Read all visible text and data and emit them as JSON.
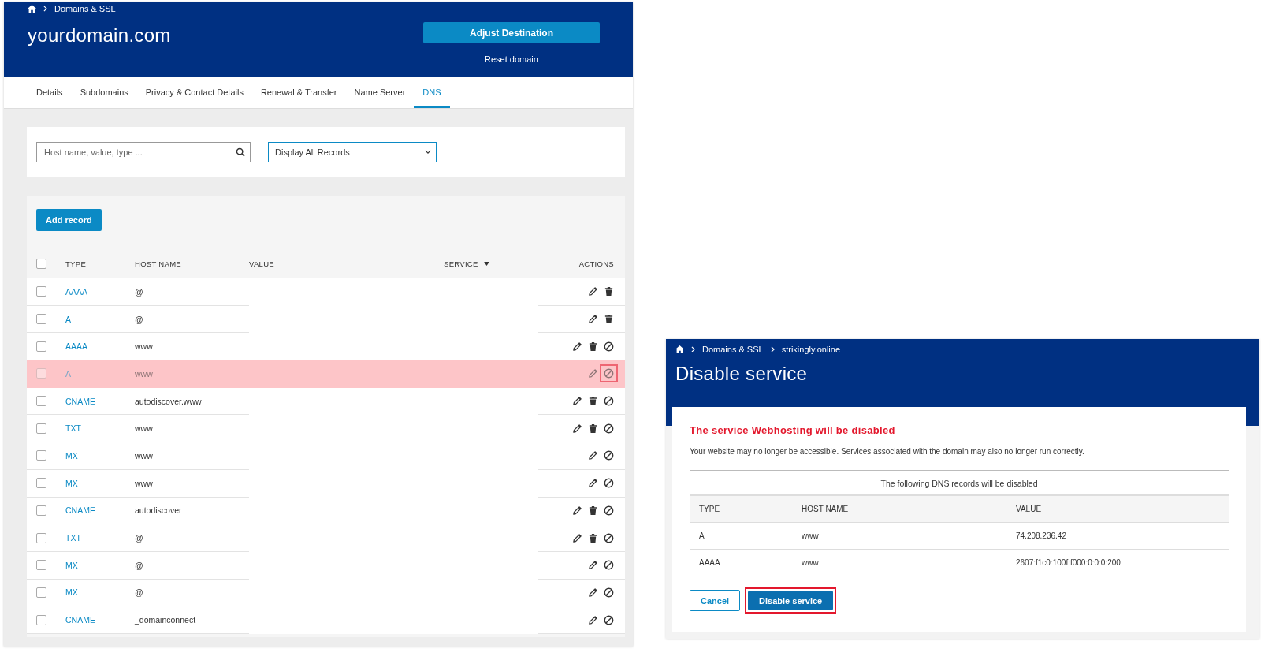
{
  "main_page": {
    "breadcrumb": [
      "Domains & SSL"
    ],
    "title": "yourdomain.com",
    "primary_button": "Adjust Destination",
    "secondary_link": "Reset domain",
    "tabs": [
      {
        "label": "Details",
        "selected": false
      },
      {
        "label": "Subdomains",
        "selected": false
      },
      {
        "label": "Privacy & Contact Details",
        "selected": false
      },
      {
        "label": "Renewal & Transfer",
        "selected": false
      },
      {
        "label": "Name Server",
        "selected": false
      },
      {
        "label": "DNS",
        "selected": true
      }
    ],
    "search": {
      "placeholder": "Host name, value, type ..."
    },
    "filter": {
      "value": "Display All Records"
    },
    "add_button": "Add record",
    "table": {
      "all_checked": false,
      "columns": [
        {
          "label": "TYPE",
          "sorted": false
        },
        {
          "label": "HOST NAME",
          "sorted": false
        },
        {
          "label": "VALUE",
          "sorted": false
        },
        {
          "label": "SERVICE",
          "sorted": true
        },
        {
          "label": "ACTIONS",
          "sorted": false
        }
      ],
      "rows": [
        {
          "type": "AAAA",
          "host": "@",
          "checked": false,
          "highlighted": false,
          "actions": [
            {
              "kind": "edit"
            },
            {
              "kind": "delete"
            }
          ]
        },
        {
          "type": "A",
          "host": "@",
          "checked": false,
          "highlighted": false,
          "actions": [
            {
              "kind": "edit"
            },
            {
              "kind": "delete"
            }
          ]
        },
        {
          "type": "AAAA",
          "host": "www",
          "checked": false,
          "highlighted": false,
          "actions": [
            {
              "kind": "edit"
            },
            {
              "kind": "delete"
            },
            {
              "kind": "disable"
            }
          ]
        },
        {
          "type": "A",
          "host": "www",
          "checked": false,
          "highlighted": true,
          "actions": [
            {
              "kind": "edit"
            },
            {
              "kind": "disable"
            }
          ]
        },
        {
          "type": "CNAME",
          "host": "autodiscover.www",
          "checked": false,
          "highlighted": false,
          "actions": [
            {
              "kind": "edit"
            },
            {
              "kind": "delete"
            },
            {
              "kind": "disable"
            }
          ]
        },
        {
          "type": "TXT",
          "host": "www",
          "checked": false,
          "highlighted": false,
          "actions": [
            {
              "kind": "edit"
            },
            {
              "kind": "delete"
            },
            {
              "kind": "disable"
            }
          ]
        },
        {
          "type": "MX",
          "host": "www",
          "checked": false,
          "highlighted": false,
          "actions": [
            {
              "kind": "edit"
            },
            {
              "kind": "disable"
            }
          ]
        },
        {
          "type": "MX",
          "host": "www",
          "checked": false,
          "highlighted": false,
          "actions": [
            {
              "kind": "edit"
            },
            {
              "kind": "disable"
            }
          ]
        },
        {
          "type": "CNAME",
          "host": "autodiscover",
          "checked": false,
          "highlighted": false,
          "actions": [
            {
              "kind": "edit"
            },
            {
              "kind": "delete"
            },
            {
              "kind": "disable"
            }
          ]
        },
        {
          "type": "TXT",
          "host": "@",
          "checked": false,
          "highlighted": false,
          "actions": [
            {
              "kind": "edit"
            },
            {
              "kind": "delete"
            },
            {
              "kind": "disable"
            }
          ]
        },
        {
          "type": "MX",
          "host": "@",
          "checked": false,
          "highlighted": false,
          "actions": [
            {
              "kind": "edit"
            },
            {
              "kind": "disable"
            }
          ]
        },
        {
          "type": "MX",
          "host": "@",
          "checked": false,
          "highlighted": false,
          "actions": [
            {
              "kind": "edit"
            },
            {
              "kind": "disable"
            }
          ]
        },
        {
          "type": "CNAME",
          "host": "_domainconnect",
          "checked": false,
          "highlighted": false,
          "actions": [
            {
              "kind": "edit"
            },
            {
              "kind": "disable"
            }
          ]
        }
      ]
    }
  },
  "dialog": {
    "breadcrumb": [
      "Domains & SSL",
      "strikingly.online"
    ],
    "title": "Disable service",
    "warning": "The service Webhosting will be disabled",
    "message": "Your website may no longer be accessible. Services associated with the domain may also no longer run correctly.",
    "records_caption": "The following DNS records will be disabled",
    "columns": [
      "TYPE",
      "HOST NAME",
      "VALUE"
    ],
    "rows": [
      {
        "type": "A",
        "host": "www",
        "value": "74.208.236.42"
      },
      {
        "type": "AAAA",
        "host": "www",
        "value": "2607:f1c0:100f:f000:0:0:0:200"
      }
    ],
    "cancel_button": "Cancel",
    "confirm_button": {
      "label": "Disable service",
      "highlighted": true
    }
  }
}
